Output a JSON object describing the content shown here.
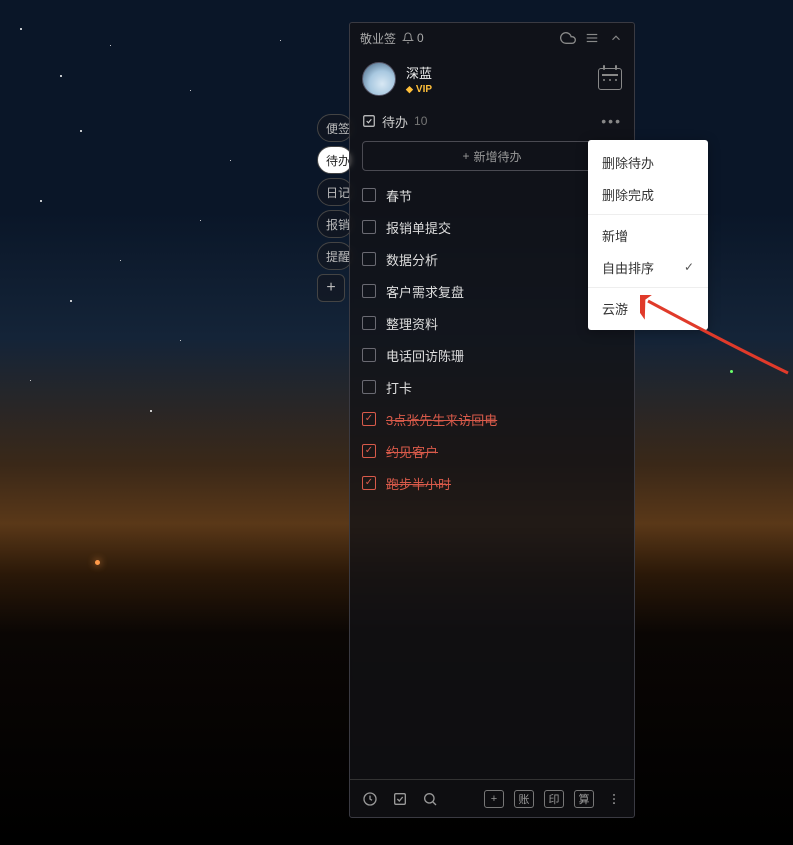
{
  "app_name": "敬业签",
  "notification_count": "0",
  "user": {
    "name": "深蓝",
    "vip_label": "VIP"
  },
  "categories": {
    "items": [
      {
        "label": "便签"
      },
      {
        "label": "待办"
      },
      {
        "label": "日记"
      },
      {
        "label": "报销"
      },
      {
        "label": "提醒"
      }
    ]
  },
  "section": {
    "title": "待办",
    "count": "10"
  },
  "add_button_label": "新增待办",
  "todos": [
    {
      "label": "春节",
      "done": false
    },
    {
      "label": "报销单提交",
      "done": false
    },
    {
      "label": "数据分析",
      "done": false
    },
    {
      "label": "客户需求复盘",
      "done": false
    },
    {
      "label": "整理资料",
      "done": false
    },
    {
      "label": "电话回访陈珊",
      "done": false
    },
    {
      "label": "打卡",
      "done": false
    },
    {
      "label": "3点张先生来访回电",
      "done": true
    },
    {
      "label": "约见客户",
      "done": true
    },
    {
      "label": "跑步半小时",
      "done": true
    }
  ],
  "menu": {
    "delete_todo": "删除待办",
    "delete_done": "删除完成",
    "add_new": "新增",
    "free_sort": "自由排序",
    "cloud_tour": "云游"
  },
  "bottombar": {
    "account": "账",
    "print": "印",
    "calc": "算"
  }
}
